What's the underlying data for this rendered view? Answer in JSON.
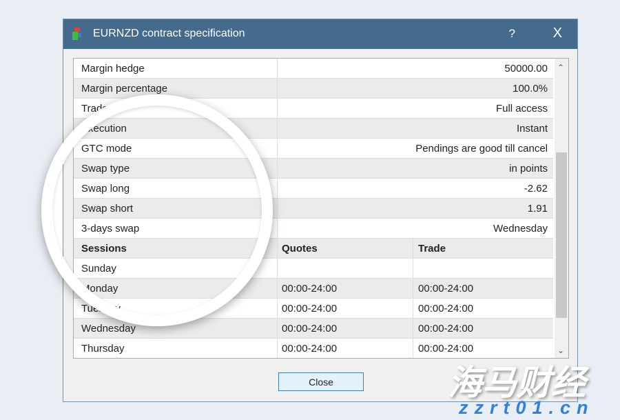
{
  "dialog": {
    "title": "EURNZD contract specification",
    "help": "?",
    "close_x": "X",
    "close_button": "Close"
  },
  "specs": [
    {
      "label": "Margin hedge",
      "value": "50000.00"
    },
    {
      "label": "Margin percentage",
      "value": "100.0%"
    },
    {
      "label": "Trade",
      "value": "Full access"
    },
    {
      "label": "Execution",
      "value": "Instant"
    },
    {
      "label": "GTC mode",
      "value": "Pendings are good till cancel"
    },
    {
      "label": "Swap type",
      "value": "in points"
    },
    {
      "label": "Swap long",
      "value": "-2.62"
    },
    {
      "label": "Swap short",
      "value": "1.91"
    },
    {
      "label": "3-days swap",
      "value": "Wednesday"
    }
  ],
  "sessions": {
    "headers": [
      "Sessions",
      "Quotes",
      "Trade"
    ],
    "rows": [
      [
        "Sunday",
        "",
        ""
      ],
      [
        "Monday",
        "00:00-24:00",
        "00:00-24:00"
      ],
      [
        "Tuesday",
        "00:00-24:00",
        "00:00-24:00"
      ],
      [
        "Wednesday",
        "00:00-24:00",
        "00:00-24:00"
      ],
      [
        "Thursday",
        "00:00-24:00",
        "00:00-24:00"
      ]
    ]
  },
  "watermark": {
    "cn": "海马财经",
    "url": "zzrt01.cn"
  }
}
